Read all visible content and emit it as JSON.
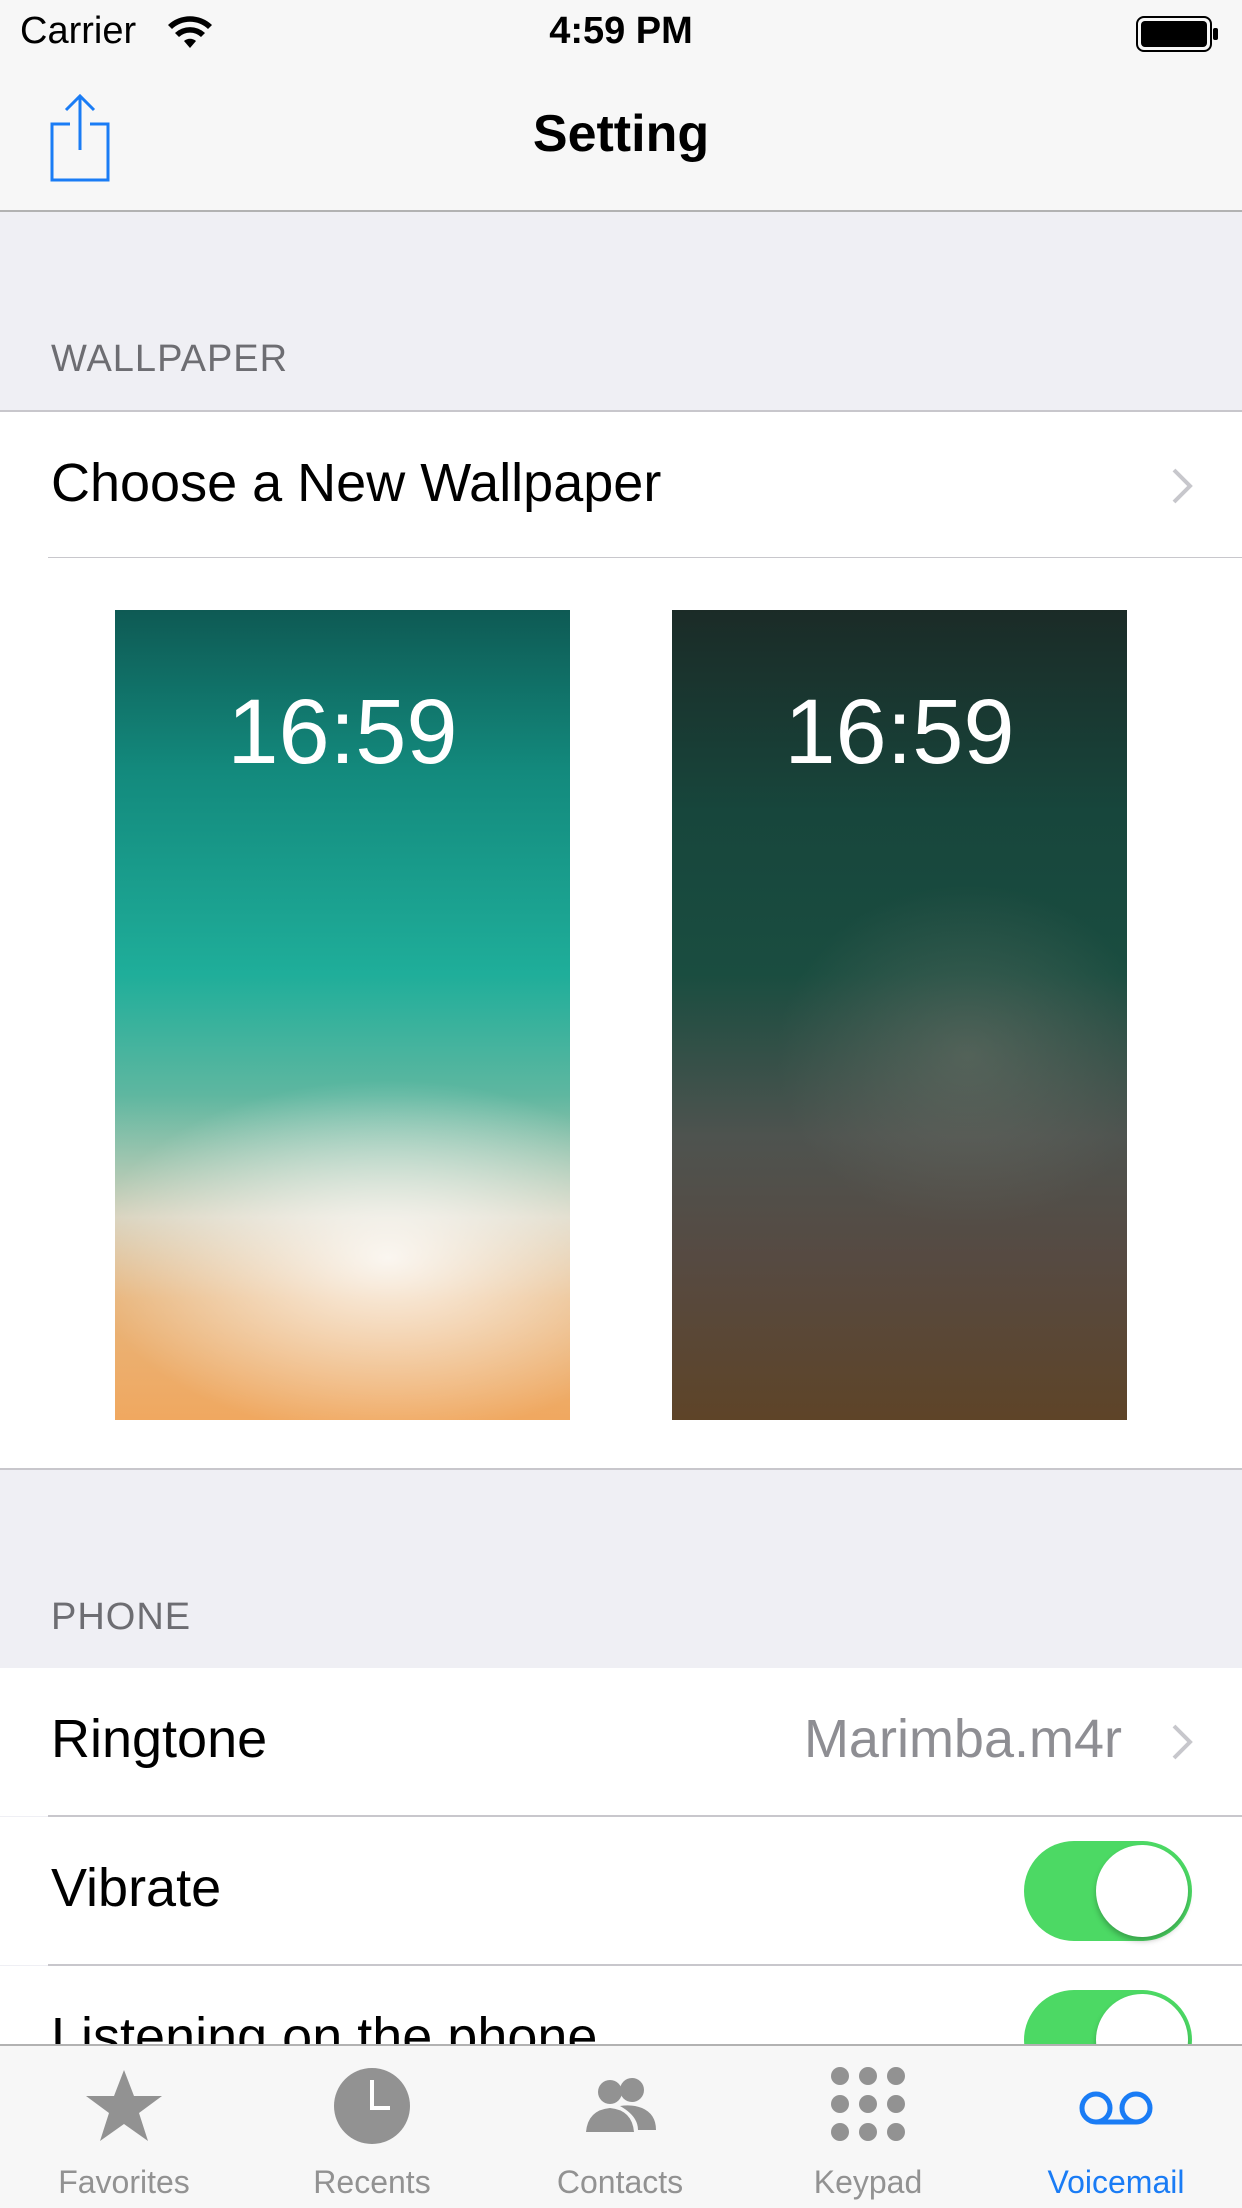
{
  "status_bar": {
    "carrier": "Carrier",
    "time": "4:59 PM"
  },
  "nav": {
    "title": "Setting",
    "share_icon": "share-icon"
  },
  "wallpaper_section": {
    "header": "WALLPAPER",
    "choose_label": "Choose a New Wallpaper",
    "previews": [
      {
        "time": "16:59"
      },
      {
        "time": "16:59"
      }
    ]
  },
  "phone_section": {
    "header": "PHONE",
    "ringtone_label": "Ringtone",
    "ringtone_value": "Marimba.m4r",
    "vibrate_label": "Vibrate",
    "vibrate_on": true,
    "listening_label": "Listening on the phone",
    "listening_on": true
  },
  "tab_bar": {
    "active_index": 4,
    "tabs": [
      {
        "label": "Favorites",
        "icon": "star-icon"
      },
      {
        "label": "Recents",
        "icon": "clock-icon"
      },
      {
        "label": "Contacts",
        "icon": "contacts-icon"
      },
      {
        "label": "Keypad",
        "icon": "keypad-icon"
      },
      {
        "label": "Voicemail",
        "icon": "voicemail-icon"
      }
    ]
  },
  "colors": {
    "accent": "#1a7cf5",
    "toggle_on": "#4cd964",
    "background": "#efeff4"
  }
}
